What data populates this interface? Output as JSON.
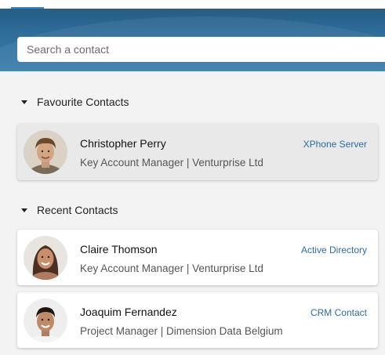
{
  "search": {
    "placeholder": "Search a contact"
  },
  "sections": {
    "favourites": {
      "title": "Favourite Contacts"
    },
    "recent": {
      "title": "Recent Contacts"
    }
  },
  "contacts": {
    "favourite": [
      {
        "name": "Christopher Perry",
        "role": "Key Account Manager | Venturprise Ltd",
        "source": "XPhone Server"
      }
    ],
    "recent": [
      {
        "name": "Claire Thomson",
        "role": "Key Account Manager | Venturprise Ltd",
        "source": "Active Directory"
      },
      {
        "name": "Joaquim Fernandez",
        "role": "Project Manager | Dimension Data Belgium",
        "source": "CRM Contact"
      }
    ]
  },
  "colors": {
    "header": "#2f6d9a",
    "accent": "#2b6ca3",
    "selected_card": "#e9e9e9"
  }
}
